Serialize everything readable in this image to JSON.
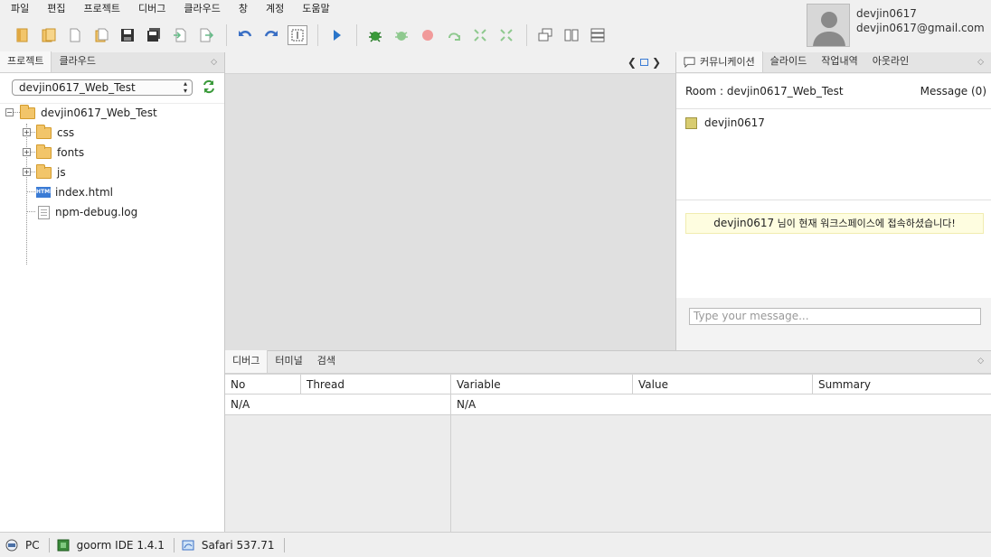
{
  "menu": [
    "파일",
    "편집",
    "프로젝트",
    "디버그",
    "클라우드",
    "창",
    "계정",
    "도움말"
  ],
  "user": {
    "name": "devjin0617",
    "email": "devjin0617@gmail.com"
  },
  "left_panel": {
    "tabs": [
      "프로젝트",
      "클라우드"
    ],
    "project_select": "devjin0617_Web_Test",
    "tree": {
      "root": "devjin0617_Web_Test",
      "folders": [
        "css",
        "fonts",
        "js"
      ],
      "files": [
        "index.html",
        "npm-debug.log"
      ]
    }
  },
  "right_panel": {
    "tabs": [
      "커뮤니케이션",
      "슬라이드",
      "작업내역",
      "아웃라인"
    ],
    "room_title": "Room : devjin0617_Web_Test",
    "message_count": "Message (0)",
    "users": [
      "devjin0617"
    ],
    "notice": {
      "user": "devjin0617",
      "text": " 님이 현재 워크스페이스에 접속하셨습니다!"
    },
    "input_placeholder": "Type your message..."
  },
  "bottom_panel": {
    "tabs": [
      "디버그",
      "터미널",
      "검색"
    ],
    "columns": [
      "No",
      "Thread",
      "Variable",
      "Value",
      "Summary"
    ],
    "row": {
      "no": "N/A",
      "variable": "N/A"
    }
  },
  "status_bar": [
    {
      "icon": "pc-icon",
      "label": "PC"
    },
    {
      "icon": "chip-icon",
      "label": "goorm IDE 1.4.1"
    },
    {
      "icon": "browser-icon",
      "label": "Safari 537.71"
    }
  ],
  "colors": {
    "accent": "#3a7bd5",
    "notice_bg": "#fefde0",
    "folder": "#f2c56a"
  }
}
